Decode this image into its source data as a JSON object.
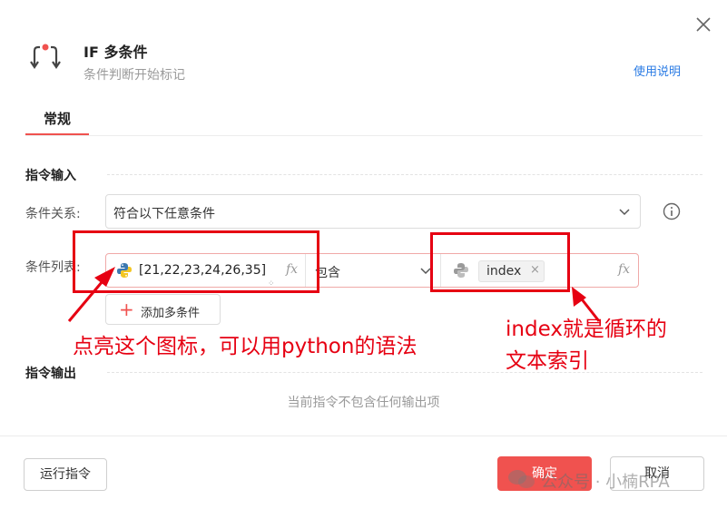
{
  "header": {
    "title": "IF 多条件",
    "subtitle": "条件判断开始标记",
    "help_link": "使用说明"
  },
  "tabs": [
    {
      "label": "常规",
      "active": true
    }
  ],
  "input_section": {
    "title": "指令输入",
    "relation": {
      "label": "条件关系:",
      "value": "符合以下任意条件"
    },
    "conditions": {
      "label": "条件列表:",
      "rows": [
        {
          "left_value": "[21,22,23,24,26,35]",
          "fx_label": "fx",
          "operator": "包含",
          "right_tag": "index",
          "right_fx_label": "fx"
        }
      ],
      "add_button": "添加多条件"
    }
  },
  "output_section": {
    "title": "指令输出",
    "empty_text": "当前指令不包含任何输出项"
  },
  "footer": {
    "run_button": "运行指令",
    "ok_button": "确定",
    "cancel_button": "取消"
  },
  "annotations": {
    "python_note": "点亮这个图标，可以用python的语法",
    "index_note_line1": "index就是循环的",
    "index_note_line2": "文本索引"
  },
  "watermark": "公众号 · 小楠RPA",
  "colors": {
    "accent": "#f0524f",
    "annotation": "#e60012",
    "link": "#2a7be4",
    "python_blue": "#3d79b0",
    "python_yellow": "#f3c623"
  },
  "icons": {
    "close": "close-icon",
    "header": "if-branch-icon",
    "info": "info-circle-icon",
    "python": "python-icon",
    "chevron": "chevron-down-icon"
  }
}
